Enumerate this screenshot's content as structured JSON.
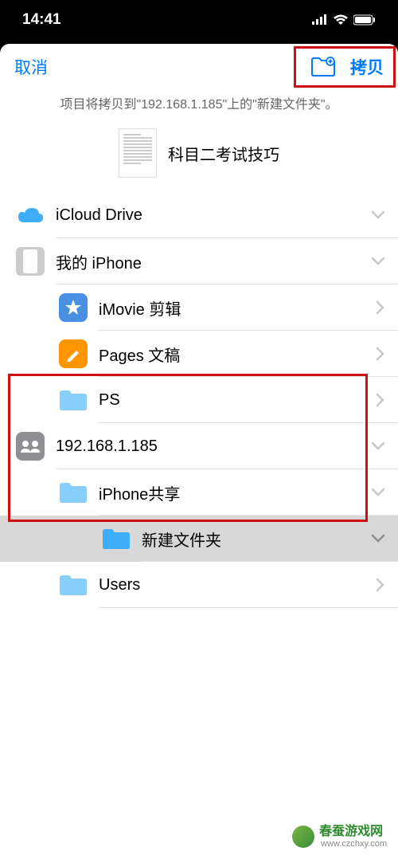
{
  "status": {
    "time": "14:41"
  },
  "header": {
    "cancel": "取消",
    "copy": "拷贝"
  },
  "subtitle": "项目将拷贝到\"192.168.1.185\"上的\"新建文件夹\"。",
  "file": {
    "title": "科目二考试技巧"
  },
  "list": {
    "icloud": "iCloud Drive",
    "iphone": "我的 iPhone",
    "imovie": "iMovie 剪辑",
    "pages": "Pages 文稿",
    "ps": "PS",
    "server": "192.168.1.185",
    "iphone_share": "iPhone共享",
    "new_folder": "新建文件夹",
    "users": "Users"
  },
  "watermark": {
    "name": "春蚕游戏网",
    "url": "www.czchxy.com"
  }
}
